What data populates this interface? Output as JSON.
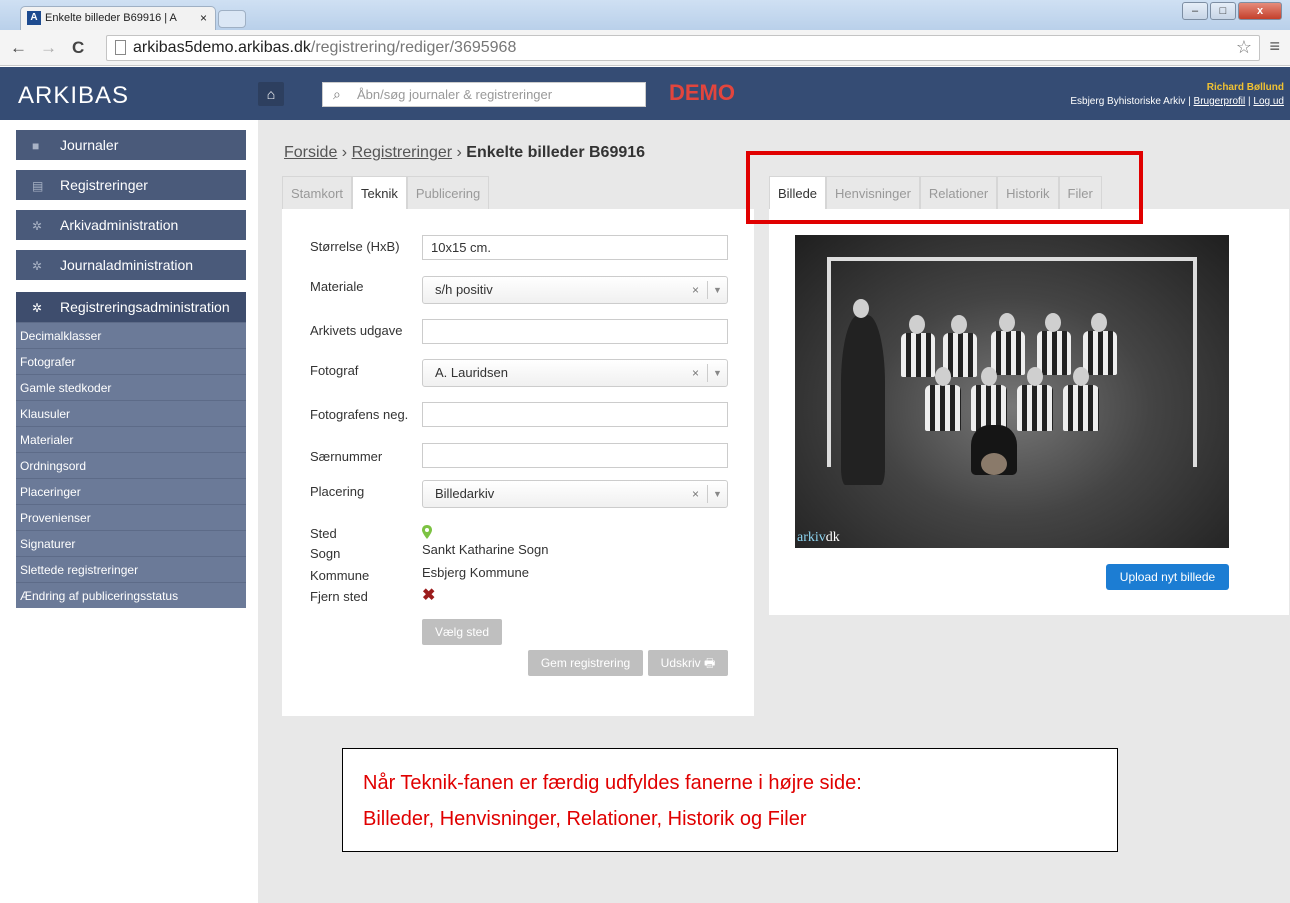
{
  "browser": {
    "tab_title": "Enkelte billeder B69916 | A",
    "tab_close": "×",
    "url_host": "arkibas5demo.arkibas.dk",
    "url_path": "/registrering/rediger/3695968",
    "back": "←",
    "forward": "→",
    "reload": "C",
    "star": "☆",
    "menu": "≡",
    "win_min": "–",
    "win_max": "□",
    "win_close": "x"
  },
  "header": {
    "logo": "ARKIBAS",
    "home": "⌂",
    "search_placeholder": "Åbn/søg journaler & registreringer",
    "demo": "DEMO",
    "user_name": "Richard Bøllund",
    "org": "Esbjerg Byhistoriske Arkiv | ",
    "profile_link": "Brugerprofil",
    "sep": " | ",
    "logout_link": "Log ud"
  },
  "sidebar": {
    "main": [
      {
        "label": "Journaler"
      },
      {
        "label": "Registreringer"
      },
      {
        "label": "Arkivadministration"
      },
      {
        "label": "Journaladministration"
      },
      {
        "label": "Registreringsadministration"
      }
    ],
    "sub": [
      "Decimalklasser",
      "Fotografer",
      "Gamle stedkoder",
      "Klausuler",
      "Materialer",
      "Ordningsord",
      "Placeringer",
      "Provenienser",
      "Signaturer",
      "Slettede registreringer",
      "Ændring af publiceringsstatus"
    ]
  },
  "breadcrumb": {
    "home": "Forside",
    "sep1": " › ",
    "reg": "Registreringer",
    "sep2": " › ",
    "current": "Enkelte billeder B69916"
  },
  "left_tabs": [
    "Stamkort",
    "Teknik",
    "Publicering"
  ],
  "form": {
    "size_label": "Størrelse (HxB)",
    "size_value": "10x15 cm.",
    "material_label": "Materiale",
    "material_value": "s/h positiv",
    "edition_label": "Arkivets udgave",
    "edition_value": "",
    "photographer_label": "Fotograf",
    "photographer_value": "A. Lauridsen",
    "neg_label": "Fotografens neg.",
    "neg_value": "",
    "special_label": "Særnummer",
    "special_value": "",
    "placement_label": "Placering",
    "placement_value": "Billedarkiv",
    "place_label": "Sted",
    "parish_label": "Sogn",
    "parish_value": "Sankt Katharine Sogn",
    "municipality_label": "Kommune",
    "municipality_value": "Esbjerg Kommune",
    "remove_label": "Fjern sted",
    "select_place_btn": "Vælg sted",
    "save_btn": "Gem registrering",
    "print_btn": "Udskriv 🖶"
  },
  "right_tabs": [
    "Billede",
    "Henvisninger",
    "Relationer",
    "Historik",
    "Filer"
  ],
  "image_panel": {
    "watermark_a": "arkiv",
    "watermark_b": "dk",
    "upload_btn": "Upload nyt billede"
  },
  "note": {
    "line1": "Når Teknik-fanen er færdig udfyldes fanerne i højre side:",
    "line2": "Billeder, Henvisninger, Relationer, Historik og Filer"
  },
  "colors": {
    "header_bg": "#354c74",
    "demo": "#e2453d",
    "annotation": "#e00000",
    "upload": "#1c7dd3"
  },
  "icons": {
    "place": "map-marker-icon",
    "remove": "remove-x-icon",
    "folder": "folder-icon",
    "gear": "gear-icon"
  }
}
